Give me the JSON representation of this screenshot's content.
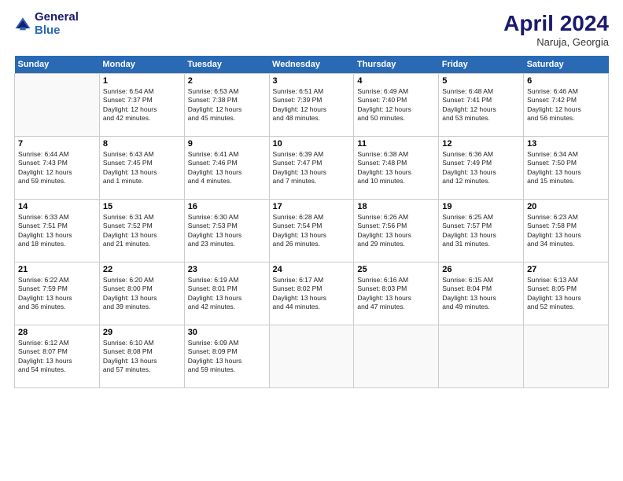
{
  "logo": {
    "line1": "General",
    "line2": "Blue"
  },
  "title": "April 2024",
  "subtitle": "Naruja, Georgia",
  "days_header": [
    "Sunday",
    "Monday",
    "Tuesday",
    "Wednesday",
    "Thursday",
    "Friday",
    "Saturday"
  ],
  "weeks": [
    [
      {
        "num": "",
        "info": ""
      },
      {
        "num": "1",
        "info": "Sunrise: 6:54 AM\nSunset: 7:37 PM\nDaylight: 12 hours\nand 42 minutes."
      },
      {
        "num": "2",
        "info": "Sunrise: 6:53 AM\nSunset: 7:38 PM\nDaylight: 12 hours\nand 45 minutes."
      },
      {
        "num": "3",
        "info": "Sunrise: 6:51 AM\nSunset: 7:39 PM\nDaylight: 12 hours\nand 48 minutes."
      },
      {
        "num": "4",
        "info": "Sunrise: 6:49 AM\nSunset: 7:40 PM\nDaylight: 12 hours\nand 50 minutes."
      },
      {
        "num": "5",
        "info": "Sunrise: 6:48 AM\nSunset: 7:41 PM\nDaylight: 12 hours\nand 53 minutes."
      },
      {
        "num": "6",
        "info": "Sunrise: 6:46 AM\nSunset: 7:42 PM\nDaylight: 12 hours\nand 56 minutes."
      }
    ],
    [
      {
        "num": "7",
        "info": "Sunrise: 6:44 AM\nSunset: 7:43 PM\nDaylight: 12 hours\nand 59 minutes."
      },
      {
        "num": "8",
        "info": "Sunrise: 6:43 AM\nSunset: 7:45 PM\nDaylight: 13 hours\nand 1 minute."
      },
      {
        "num": "9",
        "info": "Sunrise: 6:41 AM\nSunset: 7:46 PM\nDaylight: 13 hours\nand 4 minutes."
      },
      {
        "num": "10",
        "info": "Sunrise: 6:39 AM\nSunset: 7:47 PM\nDaylight: 13 hours\nand 7 minutes."
      },
      {
        "num": "11",
        "info": "Sunrise: 6:38 AM\nSunset: 7:48 PM\nDaylight: 13 hours\nand 10 minutes."
      },
      {
        "num": "12",
        "info": "Sunrise: 6:36 AM\nSunset: 7:49 PM\nDaylight: 13 hours\nand 12 minutes."
      },
      {
        "num": "13",
        "info": "Sunrise: 6:34 AM\nSunset: 7:50 PM\nDaylight: 13 hours\nand 15 minutes."
      }
    ],
    [
      {
        "num": "14",
        "info": "Sunrise: 6:33 AM\nSunset: 7:51 PM\nDaylight: 13 hours\nand 18 minutes."
      },
      {
        "num": "15",
        "info": "Sunrise: 6:31 AM\nSunset: 7:52 PM\nDaylight: 13 hours\nand 21 minutes."
      },
      {
        "num": "16",
        "info": "Sunrise: 6:30 AM\nSunset: 7:53 PM\nDaylight: 13 hours\nand 23 minutes."
      },
      {
        "num": "17",
        "info": "Sunrise: 6:28 AM\nSunset: 7:54 PM\nDaylight: 13 hours\nand 26 minutes."
      },
      {
        "num": "18",
        "info": "Sunrise: 6:26 AM\nSunset: 7:56 PM\nDaylight: 13 hours\nand 29 minutes."
      },
      {
        "num": "19",
        "info": "Sunrise: 6:25 AM\nSunset: 7:57 PM\nDaylight: 13 hours\nand 31 minutes."
      },
      {
        "num": "20",
        "info": "Sunrise: 6:23 AM\nSunset: 7:58 PM\nDaylight: 13 hours\nand 34 minutes."
      }
    ],
    [
      {
        "num": "21",
        "info": "Sunrise: 6:22 AM\nSunset: 7:59 PM\nDaylight: 13 hours\nand 36 minutes."
      },
      {
        "num": "22",
        "info": "Sunrise: 6:20 AM\nSunset: 8:00 PM\nDaylight: 13 hours\nand 39 minutes."
      },
      {
        "num": "23",
        "info": "Sunrise: 6:19 AM\nSunset: 8:01 PM\nDaylight: 13 hours\nand 42 minutes."
      },
      {
        "num": "24",
        "info": "Sunrise: 6:17 AM\nSunset: 8:02 PM\nDaylight: 13 hours\nand 44 minutes."
      },
      {
        "num": "25",
        "info": "Sunrise: 6:16 AM\nSunset: 8:03 PM\nDaylight: 13 hours\nand 47 minutes."
      },
      {
        "num": "26",
        "info": "Sunrise: 6:15 AM\nSunset: 8:04 PM\nDaylight: 13 hours\nand 49 minutes."
      },
      {
        "num": "27",
        "info": "Sunrise: 6:13 AM\nSunset: 8:05 PM\nDaylight: 13 hours\nand 52 minutes."
      }
    ],
    [
      {
        "num": "28",
        "info": "Sunrise: 6:12 AM\nSunset: 8:07 PM\nDaylight: 13 hours\nand 54 minutes."
      },
      {
        "num": "29",
        "info": "Sunrise: 6:10 AM\nSunset: 8:08 PM\nDaylight: 13 hours\nand 57 minutes."
      },
      {
        "num": "30",
        "info": "Sunrise: 6:09 AM\nSunset: 8:09 PM\nDaylight: 13 hours\nand 59 minutes."
      },
      {
        "num": "",
        "info": ""
      },
      {
        "num": "",
        "info": ""
      },
      {
        "num": "",
        "info": ""
      },
      {
        "num": "",
        "info": ""
      }
    ]
  ]
}
